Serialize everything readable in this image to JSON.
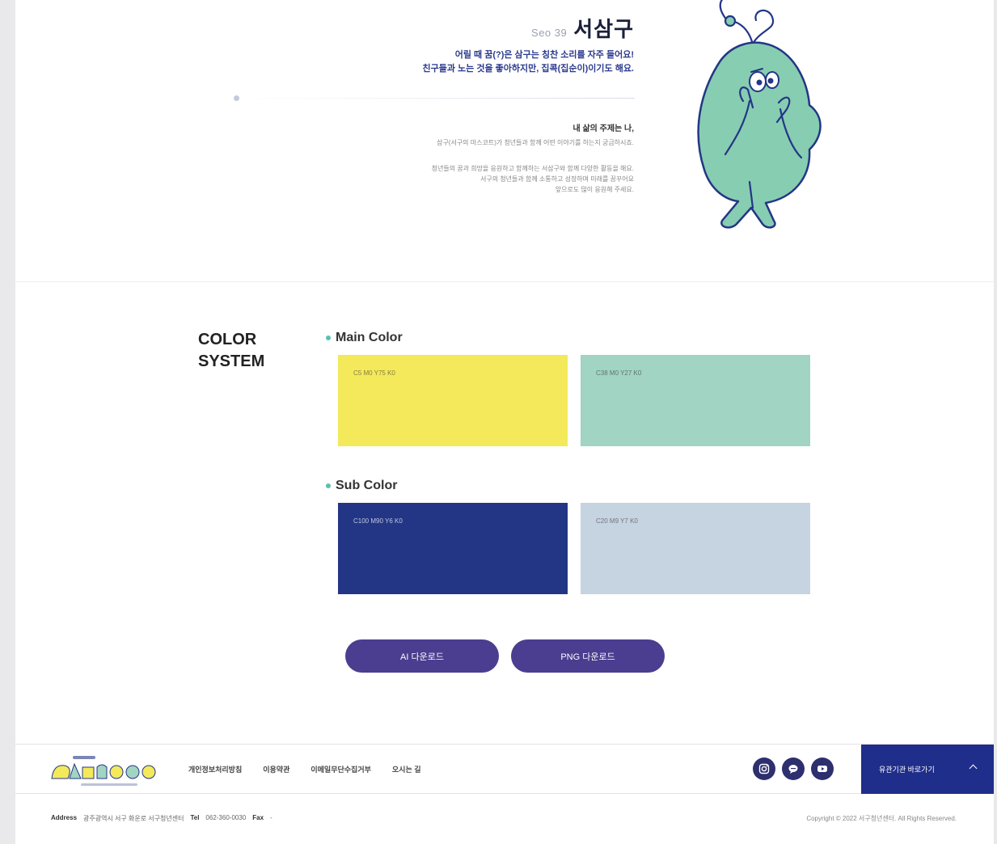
{
  "character": {
    "name_en": "Seo 39",
    "name": "서삼구",
    "intro_lines": [
      "어릴 때 꿈(?)은 삼구는 칭찬 소리를 자주 들어요!",
      "친구들과 노는 것을 좋아하지만, 집콕(집순이)이기도 해요."
    ],
    "sub_title": "내 삶의 주제는 나,",
    "desc_line": "삼구(서구의 마스코트)가 청년들과 함께 어떤 이야기를 하는지 궁금하시죠.",
    "desc_lines": [
      "청년들의 꿈과 희망을 응원하고 함께하는 서삼구와 함께 다양한 활동을 해요.",
      "서구의 청년들과 함께 소통하고 성장하며 미래를 꿈꾸어요",
      "앞으로도 많이 응원해 주세요."
    ]
  },
  "color_system": {
    "title": "COLOR\nSYSTEM",
    "main_label": "Main Color",
    "sub_label": "Sub Color",
    "main_swatches": [
      {
        "code": "C5 M0 Y75 K0",
        "hex": "#f3e95a"
      },
      {
        "code": "C38 M0 Y27 K0",
        "hex": "#a1d4c2"
      }
    ],
    "sub_swatches": [
      {
        "code": "C100 M90 Y6 K0",
        "hex": "#233686"
      },
      {
        "code": "C20 M9 Y7 K0",
        "hex": "#c6d3e0"
      }
    ]
  },
  "buttons": {
    "ai_download": "AI 다운로드",
    "png_download": "PNG 다운로드"
  },
  "footer": {
    "logo_alt": "서구청년 1939",
    "links": [
      "개인정보처리방침",
      "이용약관",
      "이메일무단수집거부",
      "오시는 길"
    ],
    "socials": [
      "instagram-icon",
      "chat-icon",
      "youtube-icon"
    ],
    "family_site": "유관기관 바로가기",
    "address_label": "Address",
    "address": "광주광역시 서구 화운로 서구청년센터",
    "tel_label": "Tel",
    "tel": "062-360-0030",
    "fax_label": "Fax",
    "fax": "-",
    "copyright": "Copyright © 2022 서구청년센터. All Rights Reserved."
  },
  "colors": {
    "accent": "#1f2e8a",
    "button": "#4b3d8f",
    "mascot": "#87cdb1",
    "outline": "#233686"
  }
}
